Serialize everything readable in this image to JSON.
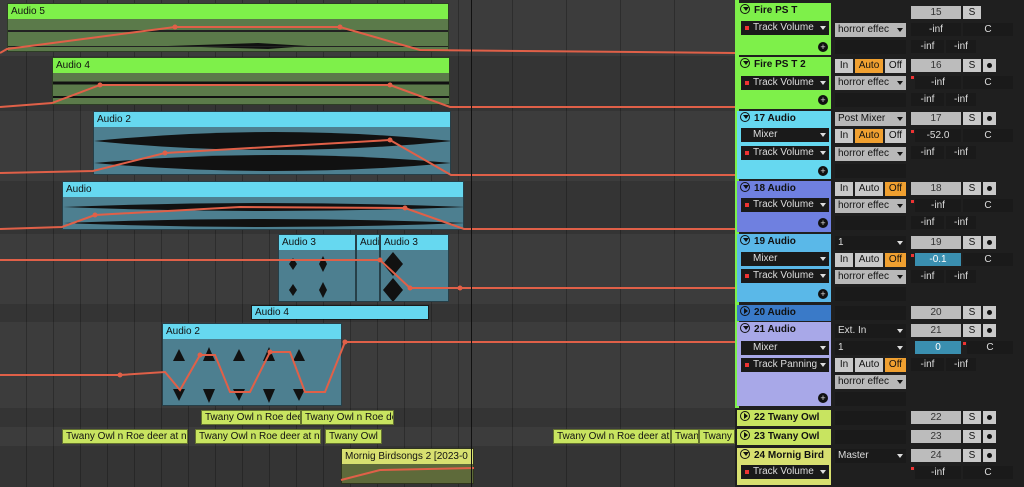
{
  "clips": {
    "audio5": "Audio 5",
    "audio4a": "Audio 4",
    "audio2a": "Audio 2",
    "audio": "Audio",
    "audio3a": "Audio 3",
    "audio3b": "Audi",
    "audio3c": "Audio 3",
    "audio4b": "Audio 4",
    "audio2b": "Audio 2",
    "owl1": "Twany Owl n Roe deer",
    "owl2": "Twany Owl n Roe de",
    "owl3": "Twany Owl n Roe deer at n",
    "owl4": "Twany Owl n Roe deer at n",
    "owl5": "Twany Owl n",
    "owl6": "Twany Owl n Roe deer at r",
    "owl7": "Twan",
    "owl8": "Twany",
    "birds": "Mornig Birdsongs 2 [2023-0"
  },
  "tracks": [
    {
      "name": "Fire PS T",
      "device": "Track Volume",
      "io": "horror effec",
      "num": "15",
      "vol": "-inf",
      "pan": "C",
      "send1": "-inf",
      "send2": "-inf"
    },
    {
      "name": "Fire PS T 2",
      "device": "Track Volume",
      "io": "horror effec",
      "num": "16",
      "vol": "-inf",
      "pan": "C",
      "send1": "-inf",
      "send2": "-inf",
      "in": "In",
      "auto": "Auto",
      "off": "Off"
    },
    {
      "name": "17 Audio",
      "mixer": "Mixer",
      "device": "Track Volume",
      "io": "Post Mixer",
      "io2": "horror effec",
      "num": "17",
      "vol": "-52.0",
      "pan": "C",
      "send1": "-inf",
      "send2": "-inf",
      "in": "In",
      "auto": "Auto",
      "off": "Off"
    },
    {
      "name": "18 Audio",
      "device": "Track Volume",
      "io": "horror effec",
      "num": "18",
      "vol": "-inf",
      "pan": "C",
      "send1": "-inf",
      "send2": "-inf",
      "in": "In",
      "auto": "Auto",
      "off": "Off"
    },
    {
      "name": "19 Audio",
      "mixer": "Mixer",
      "device": "Track Volume",
      "io": "1",
      "io2": "horror effec",
      "num": "19",
      "vol": "-0.1",
      "pan": "C",
      "send1": "-inf",
      "send2": "-inf",
      "in": "In",
      "auto": "Auto",
      "off": "Off"
    },
    {
      "name": "20 Audio",
      "num": "20"
    },
    {
      "name": "21 Audio",
      "mixer": "Mixer",
      "device": "Track Panning",
      "io": "Ext. In",
      "io1": "1",
      "io2": "horror effec",
      "num": "21",
      "vol": "0",
      "pan": "C",
      "send1": "-inf",
      "send2": "-inf",
      "in": "In",
      "auto": "Auto",
      "off": "Off"
    },
    {
      "name": "22 Twany Owl",
      "num": "22"
    },
    {
      "name": "23 Twany Owl",
      "num": "23"
    },
    {
      "name": "24 Mornig Bird",
      "device": "Track Volume",
      "io": "Master",
      "num": "24",
      "vol": "-inf",
      "pan": "C"
    }
  ],
  "labels": {
    "s": "S",
    "plus": "+"
  }
}
